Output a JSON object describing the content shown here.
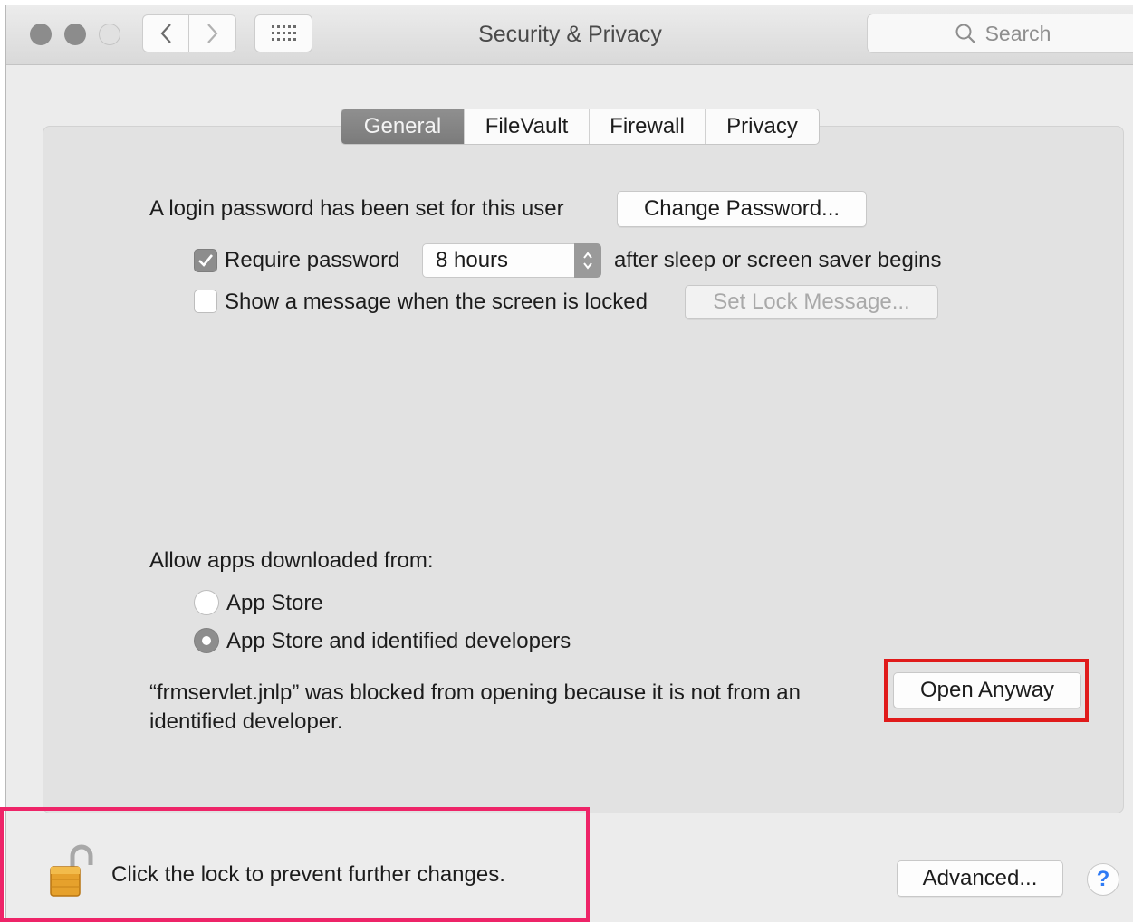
{
  "window": {
    "title": "Security & Privacy",
    "search_placeholder": "Search"
  },
  "tabs": [
    {
      "label": "General",
      "active": true
    },
    {
      "label": "FileVault",
      "active": false
    },
    {
      "label": "Firewall",
      "active": false
    },
    {
      "label": "Privacy",
      "active": false
    }
  ],
  "general": {
    "login_text": "A login password has been set for this user",
    "change_password_label": "Change Password...",
    "require_password_label": "Require password",
    "require_password_checked": true,
    "require_password_value": "8 hours",
    "after_sleep_text": "after sleep or screen saver begins",
    "show_message_label": "Show a message when the screen is locked",
    "show_message_checked": false,
    "set_lock_message_label": "Set Lock Message..."
  },
  "allow_apps": {
    "heading": "Allow apps downloaded from:",
    "option_app_store": "App Store",
    "option_identified": "App Store and identified developers",
    "selected": "App Store and identified developers",
    "blocked_line1": "“frmservlet.jnlp” was blocked from opening because it is not from an",
    "blocked_line2": "identified developer.",
    "open_anyway_label": "Open Anyway"
  },
  "footer": {
    "lock_text": "Click the lock to prevent further changes.",
    "advanced_label": "Advanced...",
    "help_label": "?"
  },
  "colors": {
    "highlight_red": "#e01a1a",
    "highlight_pink": "#ee2468",
    "help_blue": "#2f7bf5"
  }
}
